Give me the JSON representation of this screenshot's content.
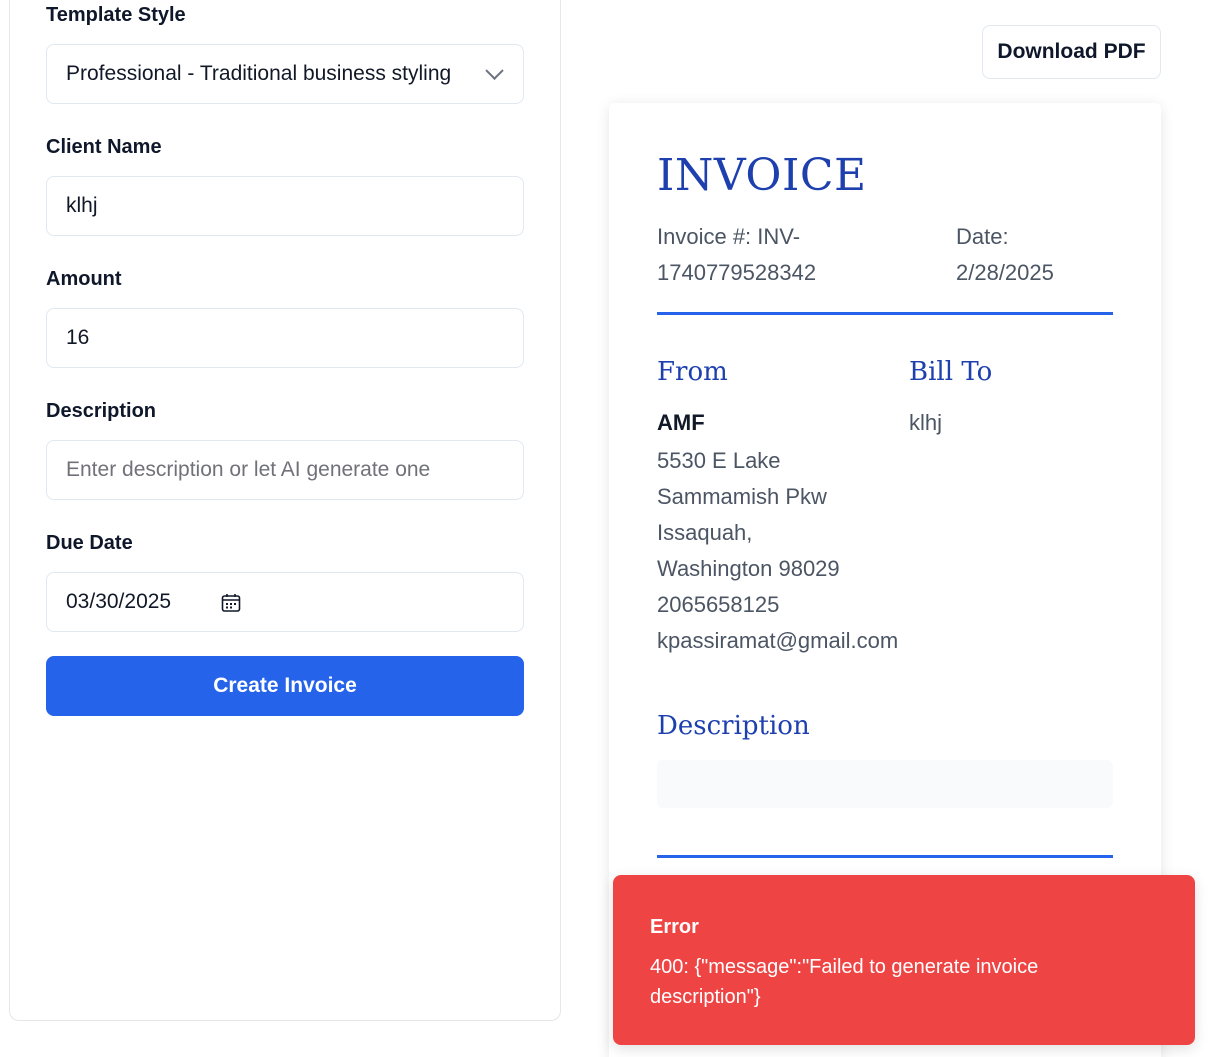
{
  "form": {
    "template_label": "Template Style",
    "template_value": "Professional - Traditional business styling",
    "client_label": "Client Name",
    "client_value": "klhj",
    "amount_label": "Amount",
    "amount_value": "16",
    "description_label": "Description",
    "description_placeholder": "Enter description or let AI generate one",
    "due_label": "Due Date",
    "due_value": "03/30/2025",
    "create_label": "Create Invoice"
  },
  "toolbar": {
    "download_label": "Download PDF"
  },
  "invoice": {
    "title": "INVOICE",
    "number_prefix": "Invoice #: INV-",
    "number_value": "1740779528342",
    "date_label": "Date:",
    "date_value": "2/28/2025",
    "from_heading": "From",
    "bill_heading": "Bill To",
    "from_name": "AMF",
    "from_lines": [
      "5530 E Lake",
      "Sammamish Pkw",
      "Issaquah,",
      "Washington 98029",
      "2065658125",
      "kpassiramat@gmail.com"
    ],
    "bill_name": "klhj",
    "description_heading": "Description"
  },
  "toast": {
    "title": "Error",
    "message": "400: {\"message\":\"Failed to generate invoice description\"}"
  },
  "colors": {
    "accent": "#2563eb",
    "heading": "#1e40af",
    "error": "#ef4444"
  }
}
